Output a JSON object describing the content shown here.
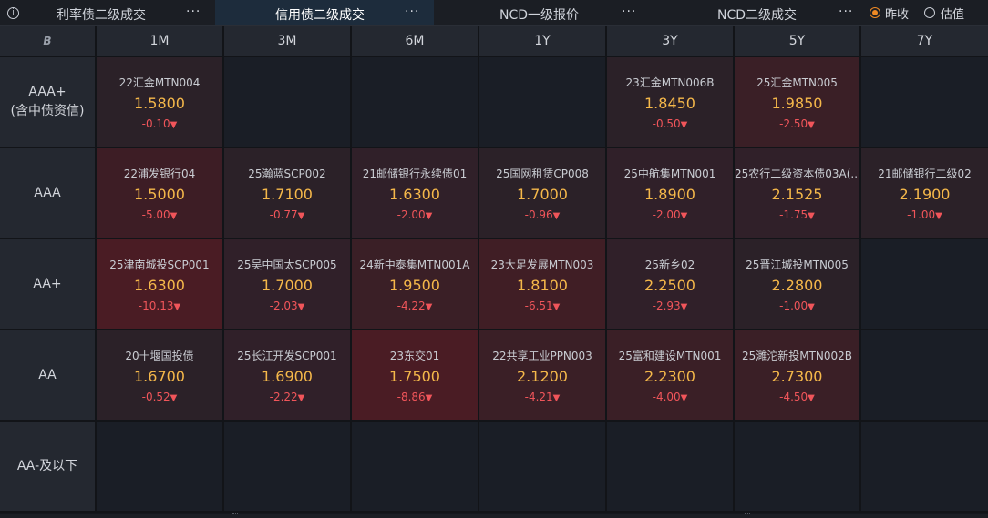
{
  "tabs": [
    {
      "label": "利率债二级成交",
      "active": false
    },
    {
      "label": "信用债二级成交",
      "active": true
    },
    {
      "label": "NCD一级报价",
      "active": false
    },
    {
      "label": "NCD二级成交",
      "active": false
    }
  ],
  "info_icon": "ⓘ",
  "more_glyph": "···",
  "radios": [
    {
      "label": "昨收",
      "checked": true
    },
    {
      "label": "估值",
      "checked": false
    }
  ],
  "corner_icon": "B",
  "tenors": [
    "1M",
    "3M",
    "6M",
    "1Y",
    "3Y",
    "5Y",
    "7Y"
  ],
  "ratings": [
    {
      "line1": "AAA+",
      "line2": "(含中债资信)"
    },
    {
      "line1": "AAA",
      "line2": ""
    },
    {
      "line1": "AA+",
      "line2": ""
    },
    {
      "line1": "AA",
      "line2": ""
    },
    {
      "line1": "AA-及以下",
      "line2": ""
    }
  ],
  "down_arrow": "▼",
  "colors": {
    "empty": "#1a1e26",
    "rate": "#f5b84a",
    "change_down": "#f0555a",
    "radio_checked": "#f08a24"
  },
  "cells": [
    [
      {
        "bond": "22汇金MTN004",
        "rate": "1.5800",
        "change": "-0.10",
        "bg": "#2b2128"
      },
      null,
      null,
      null,
      {
        "bond": "23汇金MTN006B",
        "rate": "1.8450",
        "change": "-0.50",
        "bg": "#2b2128"
      },
      {
        "bond": "25汇金MTN005",
        "rate": "1.9850",
        "change": "-2.50",
        "bg": "#3a1f26"
      },
      null
    ],
    [
      {
        "bond": "22浦发银行04",
        "rate": "1.5000",
        "change": "-5.00",
        "bg": "#3d1d25"
      },
      {
        "bond": "25瀚蓝SCP002",
        "rate": "1.7100",
        "change": "-0.77",
        "bg": "#2b2128"
      },
      {
        "bond": "21邮储银行永续债01",
        "rate": "1.6300",
        "change": "-2.00",
        "bg": "#302029"
      },
      {
        "bond": "25国网租赁CP008",
        "rate": "1.7000",
        "change": "-0.96",
        "bg": "#2b2128"
      },
      {
        "bond": "25中航集MTN001",
        "rate": "1.8900",
        "change": "-2.00",
        "bg": "#302029"
      },
      {
        "bond": "25农行二级资本债03A(...",
        "rate": "2.1525",
        "change": "-1.75",
        "bg": "#302029"
      },
      {
        "bond": "21邮储银行二级02",
        "rate": "2.1900",
        "change": "-1.00",
        "bg": "#2b2128"
      }
    ],
    [
      {
        "bond": "25津南城投SCP001",
        "rate": "1.6300",
        "change": "-10.13",
        "bg": "#4a1c24"
      },
      {
        "bond": "25吴中国太SCP005",
        "rate": "1.7000",
        "change": "-2.03",
        "bg": "#302029"
      },
      {
        "bond": "24新中泰集MTN001A",
        "rate": "1.9500",
        "change": "-4.22",
        "bg": "#3a1f26"
      },
      {
        "bond": "23大足发展MTN003",
        "rate": "1.8100",
        "change": "-6.51",
        "bg": "#401e25"
      },
      {
        "bond": "25新乡02",
        "rate": "2.2500",
        "change": "-2.93",
        "bg": "#302029"
      },
      {
        "bond": "25晋江城投MTN005",
        "rate": "2.2800",
        "change": "-1.00",
        "bg": "#2b2128"
      },
      null
    ],
    [
      {
        "bond": "20十堰国投债",
        "rate": "1.6700",
        "change": "-0.52",
        "bg": "#2b2128"
      },
      {
        "bond": "25长江开发SCP001",
        "rate": "1.6900",
        "change": "-2.22",
        "bg": "#302029"
      },
      {
        "bond": "23东交01",
        "rate": "1.7500",
        "change": "-8.86",
        "bg": "#4a1c24"
      },
      {
        "bond": "22共享工业PPN003",
        "rate": "2.1200",
        "change": "-4.21",
        "bg": "#3a1f26"
      },
      {
        "bond": "25富和建设MTN001",
        "rate": "2.2300",
        "change": "-4.00",
        "bg": "#3a1f26"
      },
      {
        "bond": "25濉沱新投MTN002B",
        "rate": "2.7300",
        "change": "-4.50",
        "bg": "#3a1f26"
      },
      null
    ],
    [
      null,
      null,
      null,
      null,
      null,
      null,
      null
    ]
  ]
}
